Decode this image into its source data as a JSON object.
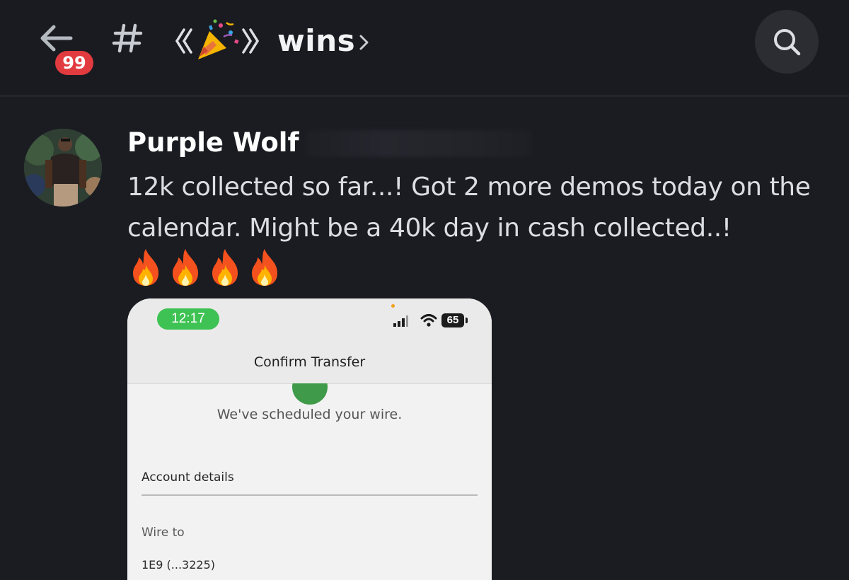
{
  "header": {
    "back_label": "Back",
    "unread_badge": "99",
    "channel_prefix": "#",
    "channel_emoji": "party-popper-icon",
    "channel_name": "wins",
    "chevron": "›",
    "search_icon": "search-icon"
  },
  "message": {
    "author": "Purple Wolf",
    "text": "12k collected so far...! Got 2 more demos today on the calendar. Might be a 40k day in cash collected..!",
    "reactions_inline": [
      "🔥",
      "🔥",
      "🔥",
      "🔥"
    ]
  },
  "attachment": {
    "status_time": "12:17",
    "battery": "65",
    "title": "Confirm Transfer",
    "confirmation": "We've scheduled your wire.",
    "section_title": "Account details",
    "field_label": "Wire to",
    "field_value": "1E9 (...3225)"
  },
  "colors": {
    "background": "#1b1c22",
    "badge": "#e23b3f",
    "accent_green": "#3ec253",
    "text_primary": "#ffffff",
    "text_secondary": "#dbdee1"
  }
}
